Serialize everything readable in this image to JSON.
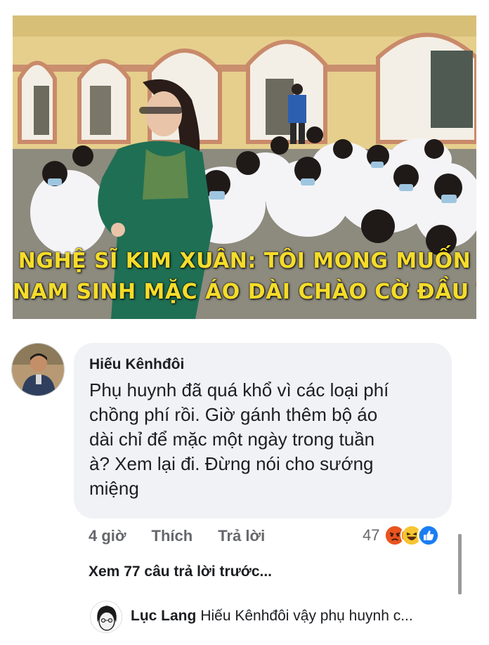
{
  "photo": {
    "headline_line1": "NGHỆ SĨ KIM XUÂN: TÔI MONG MUỐN",
    "headline_line2": "NAM SINH MẶC ÁO DÀI CHÀO CỜ ĐẦU TUẦN"
  },
  "comment": {
    "author": "Hiếu Kênhđôi",
    "lines": [
      "Phụ huynh đã quá khổ vì các loại phí",
      "chồng phí rồi. Giờ gánh thêm bộ áo",
      "dài chỉ để mặc một ngày trong tuần",
      "à? Xem lại đi. Đừng nói cho sướng",
      "miệng"
    ],
    "time": "4 giờ",
    "like_label": "Thích",
    "reply_label": "Trả lời",
    "reaction_count": "47",
    "reactions": [
      "angry-emoji",
      "haha-emoji",
      "like-emoji"
    ]
  },
  "more_replies": "Xem 77 câu trả lời trước...",
  "reply": {
    "author": "Lục Lang",
    "text": "Hiếu Kênhđôi vậy phụ huynh c..."
  }
}
